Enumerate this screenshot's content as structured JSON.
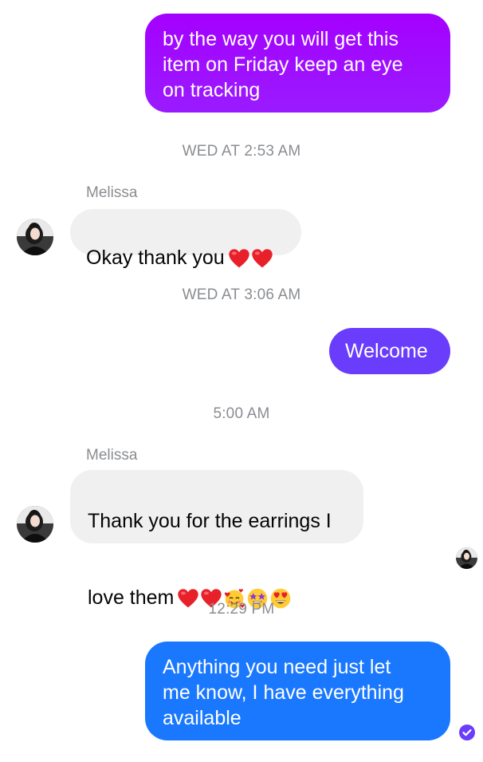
{
  "conversation": {
    "messages": [
      {
        "direction": "outgoing",
        "text": "by the way you will get this\nitem on Friday keep an eye\non tracking"
      },
      {
        "direction": "incoming",
        "sender": "Melissa",
        "text": "Okay thank you",
        "emojis": [
          "red-heart",
          "red-heart"
        ]
      },
      {
        "direction": "outgoing",
        "text": "Welcome"
      },
      {
        "direction": "incoming",
        "sender": "Melissa",
        "text_line1": "Thank you for the earrings I",
        "text_line2": "love them",
        "emojis": [
          "red-heart",
          "red-heart",
          "smiling-face-with-hearts",
          "star-struck",
          "heart-eyes"
        ]
      },
      {
        "direction": "outgoing",
        "text": "Anything you need just let\nme know, I have everything\navailable"
      }
    ],
    "timestamps": [
      "WED AT 2:53 AM",
      "WED AT 3:06 AM",
      "5:00 AM",
      "12:29 PM"
    ],
    "sender_name": "Melissa"
  },
  "colors": {
    "outgoing_1": "#a400ff",
    "outgoing_2": "#6a3dfc",
    "outgoing_3": "#1a78ff",
    "incoming": "#f0f0f0",
    "timestamp": "#8a8d91",
    "seen_icon": "#6a3dfc"
  },
  "icons": [
    "avatar",
    "red-heart-icon",
    "smiling-face-with-hearts-icon",
    "star-struck-icon",
    "heart-eyes-icon",
    "delivered-check-icon"
  ]
}
